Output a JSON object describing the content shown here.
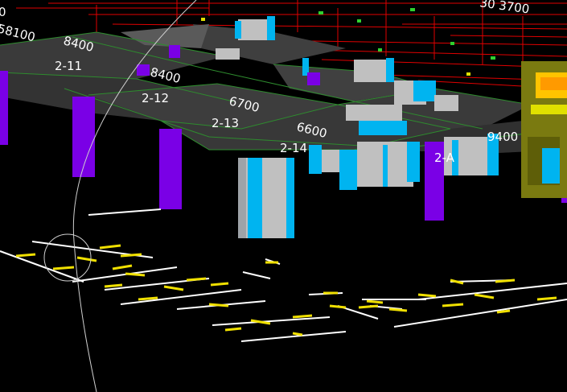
{
  "window": {
    "title": ""
  },
  "viewport": {
    "background": "#000000",
    "colors": {
      "slab": "#3a3a3a",
      "slab_edge": "#2e8b2e",
      "column": "#7a00e6",
      "pipe_cyan": "#00b4f0",
      "pipe_gray": "#c0c0c0",
      "red_lines": "#e00000",
      "yellow_marks": "#f0e000",
      "white_lines": "#ffffff",
      "equipment_olive": "#7a7a10",
      "equipment_yellow": "#ffc400"
    },
    "dimension_labels": {
      "top_left": "0",
      "d_58100": "58100",
      "d_8400_a": "8400",
      "d_8400_b": "8400",
      "d_6700": "6700",
      "d_6600": "6600",
      "d_9400": "9400",
      "top_right": "30 3700"
    },
    "grid_labels": {
      "g_2_11": "2-11",
      "g_2_12": "2-12",
      "g_2_13": "2-13",
      "g_2_14": "2-14",
      "g_2_A": "2-A"
    },
    "navigation": {
      "compass_ring": "view-compass-ring",
      "orbit_cursor": "orbit-cursor-icon"
    }
  }
}
